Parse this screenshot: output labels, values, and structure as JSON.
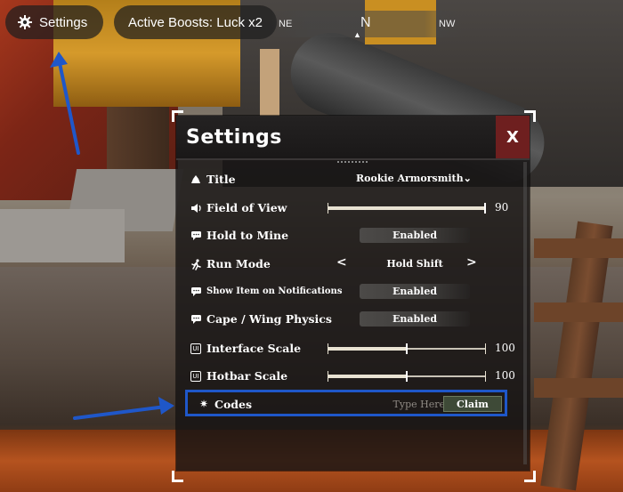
{
  "hud": {
    "settings_label": "Settings",
    "boosts_label": "Active Boosts: Luck x2",
    "compass": {
      "left": "NE",
      "center": "N",
      "right": "NW"
    }
  },
  "panel": {
    "title": "Settings",
    "close_label": "X",
    "rows": {
      "title": {
        "label": "Title",
        "value": "Rookie Armorsmith"
      },
      "fov": {
        "label": "Field of View",
        "value": "90",
        "level": 1.0
      },
      "hold_to_mine": {
        "label": "Hold to Mine",
        "value": "Enabled"
      },
      "run_mode": {
        "label": "Run Mode",
        "value": "Hold Shift",
        "prev": "<",
        "next": ">"
      },
      "show_item": {
        "label": "Show Item on Notifications",
        "value": "Enabled"
      },
      "cape_wing": {
        "label": "Cape / Wing Physics",
        "value": "Enabled"
      },
      "interface_scale": {
        "label": "Interface Scale",
        "value": "100",
        "level": 0.5,
        "icon_text": "UI"
      },
      "hotbar_scale": {
        "label": "Hotbar Scale",
        "value": "100",
        "level": 0.5,
        "icon_text": "UI"
      },
      "codes": {
        "label": "Codes",
        "placeholder": "Type Here",
        "claim_label": "Claim"
      }
    }
  },
  "colors": {
    "highlight": "#1f57c9",
    "close_button": "#6e1f1f",
    "claim_button": "#3e4a37"
  }
}
